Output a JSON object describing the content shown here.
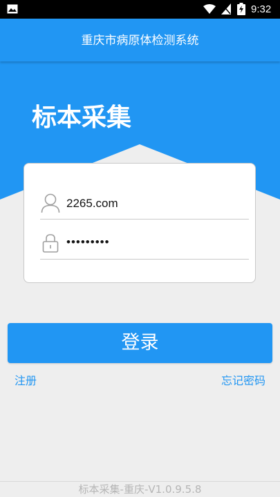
{
  "status_bar": {
    "time": "9:32",
    "icons": [
      "gallery-icon",
      "wifi-icon",
      "signal-icon",
      "battery-charging-icon"
    ]
  },
  "app_bar": {
    "title": "重庆市病原体检测系统"
  },
  "hero": {
    "title": "标本采集"
  },
  "login_form": {
    "username": {
      "value": "2265.com",
      "icon": "user-icon"
    },
    "password": {
      "value": "•••••••••",
      "icon": "lock-icon"
    }
  },
  "actions": {
    "login_label": "登录",
    "register_label": "注册",
    "forgot_label": "忘记密码"
  },
  "footer": {
    "version": "标本采集-重庆-V1.0.9.5.8"
  },
  "colors": {
    "primary": "#2196f3",
    "background": "#eeeeee",
    "status_bar": "#000000"
  }
}
